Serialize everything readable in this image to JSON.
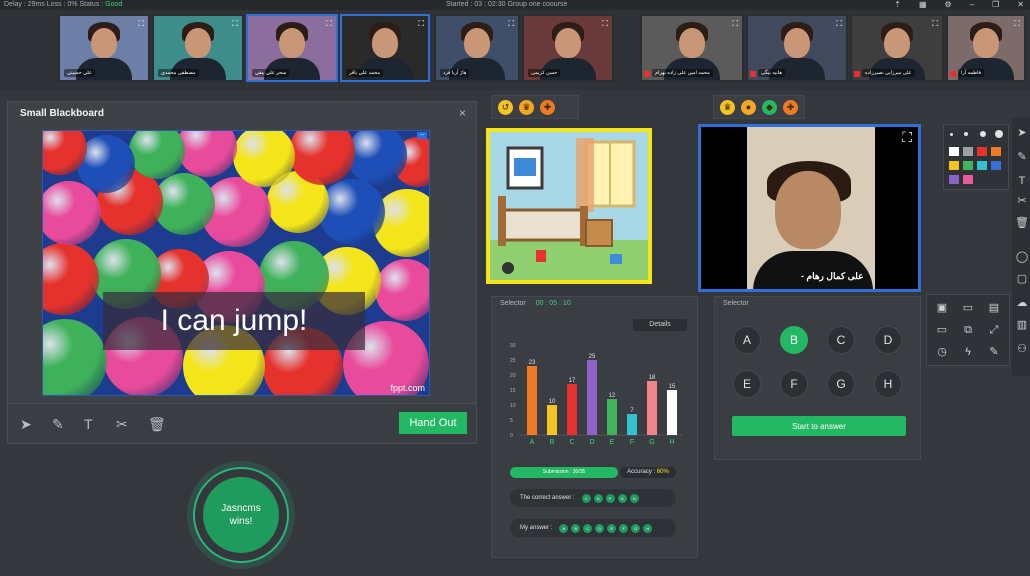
{
  "status": {
    "left_text": "Delay : 29ms  Loss : 0%  Status :",
    "status_value": "Good",
    "center_text": "Started : 03 : 02:30   Group  one  coourse"
  },
  "participants": [
    {
      "name": "علي حسيني",
      "color": "#6d7fa6"
    },
    {
      "name": "مصطفى محمدي",
      "color": "#3e8d8a"
    },
    {
      "name": "سحر علي بيقي",
      "color": "#8b6d9e"
    },
    {
      "name": "محمد علي باقر",
      "color": "#2a2a2a"
    },
    {
      "name": "هاژ آریا فرد",
      "color": "#3f4f6a"
    },
    {
      "name": "حسن کریمی",
      "color": "#6a3a3a"
    },
    {
      "name": "محمد امین علی زاده بهرام",
      "color": "#5b5b5b"
    },
    {
      "name": "هانیه بیگی",
      "color": "#414a5c"
    },
    {
      "name": "علی میرزایی نصیرزاده",
      "color": "#3e3e3e"
    },
    {
      "name": "فاطمه آرا",
      "color": "#7d6a6a"
    }
  ],
  "blackboard": {
    "title": "Small Blackboard",
    "close_icon": "×",
    "banner_text": "I can jump!",
    "watermark": "fppt.com",
    "handout_label": "Hand Out"
  },
  "winner": {
    "line1": "Jasncms",
    "line2": "wins!"
  },
  "big_video": {
    "name": "- علی کمال رهام"
  },
  "stats": {
    "header": "Selector",
    "timer": "00 : 05 : 10",
    "details_label": "Details",
    "chart_data": {
      "type": "bar",
      "categories": [
        "A",
        "B",
        "C",
        "D",
        "E",
        "F",
        "G",
        "H"
      ],
      "values": [
        23,
        10,
        17,
        25,
        12,
        7,
        18,
        15
      ],
      "ylim": [
        0,
        30
      ],
      "yticks": [
        0,
        5,
        10,
        15,
        20,
        25,
        30
      ],
      "colors": [
        "#f07a23",
        "#f4c423",
        "#e5322d",
        "#8d62c6",
        "#41b35a",
        "#33c1cf",
        "#f08585",
        "#ffffff"
      ]
    },
    "submission_label": "Submission : 30/35",
    "accuracy_label": "Accuracy :",
    "accuracy_value": "60%",
    "correct_label": "The correct answer :",
    "correct_answers": [
      "C",
      "D",
      "F",
      "G",
      "H"
    ],
    "my_label": "My answer :",
    "my_answers": [
      "A",
      "B",
      "C",
      "D",
      "E",
      "F",
      "G",
      "H"
    ]
  },
  "choices": {
    "header": "Selector",
    "options": [
      "A",
      "B",
      "C",
      "D",
      "E",
      "F",
      "G",
      "H"
    ],
    "selected": "B",
    "start_label": "Start to answer"
  },
  "palette": [
    "#ffffff",
    "#9aa0a6",
    "#e5322d",
    "#f07a23",
    "#f4c423",
    "#41b35a",
    "#33c1cf",
    "#3b6fd8",
    "#8d62c6",
    "#e95d9a"
  ]
}
